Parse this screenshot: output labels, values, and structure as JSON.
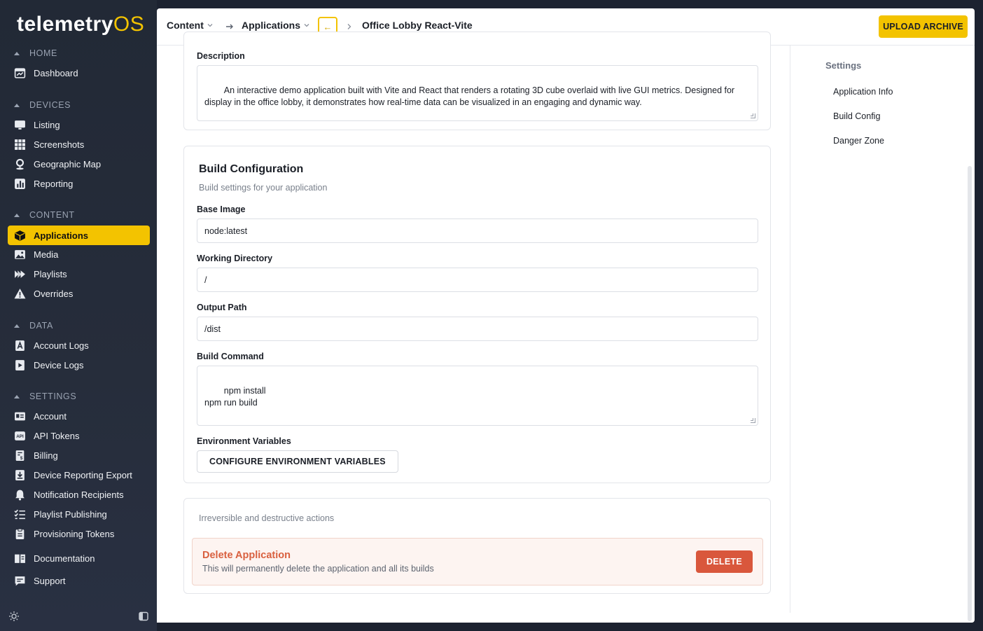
{
  "brand": {
    "logo_main": "telemetry",
    "logo_accent": "OS",
    "accent_color": "#f3c300"
  },
  "sidebar": {
    "sections": [
      {
        "label": "HOME"
      },
      {
        "label": "DEVICES"
      },
      {
        "label": "CONTENT"
      },
      {
        "label": "DATA"
      },
      {
        "label": "SETTINGS"
      }
    ],
    "items": [
      {
        "label": "Dashboard",
        "icon": "dashboard-icon"
      },
      {
        "label": "Listing",
        "icon": "monitor-icon"
      },
      {
        "label": "Screenshots",
        "icon": "grid-icon"
      },
      {
        "label": "Geographic Map",
        "icon": "map-pin-icon"
      },
      {
        "label": "Reporting",
        "icon": "bar-chart-icon"
      },
      {
        "label": "Applications",
        "icon": "cube-icon",
        "active": true
      },
      {
        "label": "Media",
        "icon": "image-icon"
      },
      {
        "label": "Playlists",
        "icon": "playlist-icon"
      },
      {
        "label": "Overrides",
        "icon": "warning-icon"
      },
      {
        "label": "Account Logs",
        "icon": "account-log-icon"
      },
      {
        "label": "Device Logs",
        "icon": "device-log-icon"
      },
      {
        "label": "Account",
        "icon": "id-card-icon"
      },
      {
        "label": "API Tokens",
        "icon": "api-icon"
      },
      {
        "label": "Billing",
        "icon": "billing-icon"
      },
      {
        "label": "Device Reporting Export",
        "icon": "download-icon"
      },
      {
        "label": "Notification Recipients",
        "icon": "bell-icon"
      },
      {
        "label": "Playlist Publishing",
        "icon": "checklist-icon"
      },
      {
        "label": "Provisioning Tokens",
        "icon": "clipboard-icon"
      },
      {
        "label": "Documentation",
        "icon": "book-icon"
      },
      {
        "label": "Support",
        "icon": "chat-icon"
      }
    ],
    "api_icon_text": "API"
  },
  "header": {
    "crumb_content": "Content",
    "crumb_applications": "Applications",
    "back_arrow": "←",
    "crumb_current": "Office Lobby React-Vite",
    "upload_label": "UPLOAD ARCHIVE"
  },
  "description": {
    "label": "Description",
    "value": "An interactive demo application built with Vite and React that renders a rotating 3D cube overlaid with live GUI metrics. Designed for display in the office lobby, it demonstrates how real-time data can be visualized in an engaging and dynamic way."
  },
  "build": {
    "title": "Build Configuration",
    "subtitle": "Build settings for your application",
    "base_image_label": "Base Image",
    "base_image_value": "node:latest",
    "working_dir_label": "Working Directory",
    "working_dir_value": "/",
    "output_path_label": "Output Path",
    "output_path_value": "/dist",
    "build_command_label": "Build Command",
    "build_command_value": "npm install\nnpm run build",
    "env_label": "Environment Variables",
    "env_button": "CONFIGURE ENVIRONMENT VARIABLES"
  },
  "danger": {
    "subtitle": "Irreversible and destructive actions",
    "title": "Delete Application",
    "description": "This will permanently delete the application and all its builds",
    "delete_label": "DELETE",
    "delete_color": "#d9573c"
  },
  "toc": {
    "heading": "Settings",
    "items": [
      "Application Info",
      "Build Config",
      "Danger Zone"
    ]
  }
}
